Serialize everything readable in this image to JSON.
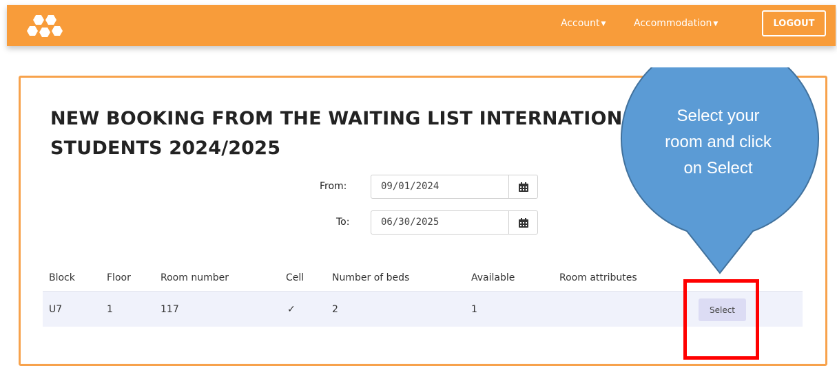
{
  "topbar": {
    "logo": "hexagon-logo",
    "nav": [
      {
        "label": "Account"
      },
      {
        "label": "Accommodation"
      }
    ],
    "logout_label": "LOGOUT"
  },
  "booking": {
    "title": "NEW BOOKING FROM THE WAITING LIST INTERNATIONAL STUDENTS 2024/2025",
    "from_label": "From:",
    "from_value": "09/01/2024",
    "to_label": "To:",
    "to_value": "06/30/2025"
  },
  "table": {
    "headers": [
      "Block",
      "Floor",
      "Room number",
      "Cell",
      "Number of beds",
      "Available",
      "Room attributes"
    ],
    "rows": [
      {
        "block": "U7",
        "floor": "1",
        "room_number": "117",
        "cell": "✓",
        "beds": "2",
        "available": "1",
        "attributes": "",
        "action_label": "Select"
      }
    ]
  },
  "annotation": {
    "callout_text": "Select your room and click on Select",
    "callout_color": "#5b9bd5",
    "highlight_color": "#ff0000"
  },
  "colors": {
    "brand": "#f89c3a",
    "panel_border": "#f7a24c"
  }
}
